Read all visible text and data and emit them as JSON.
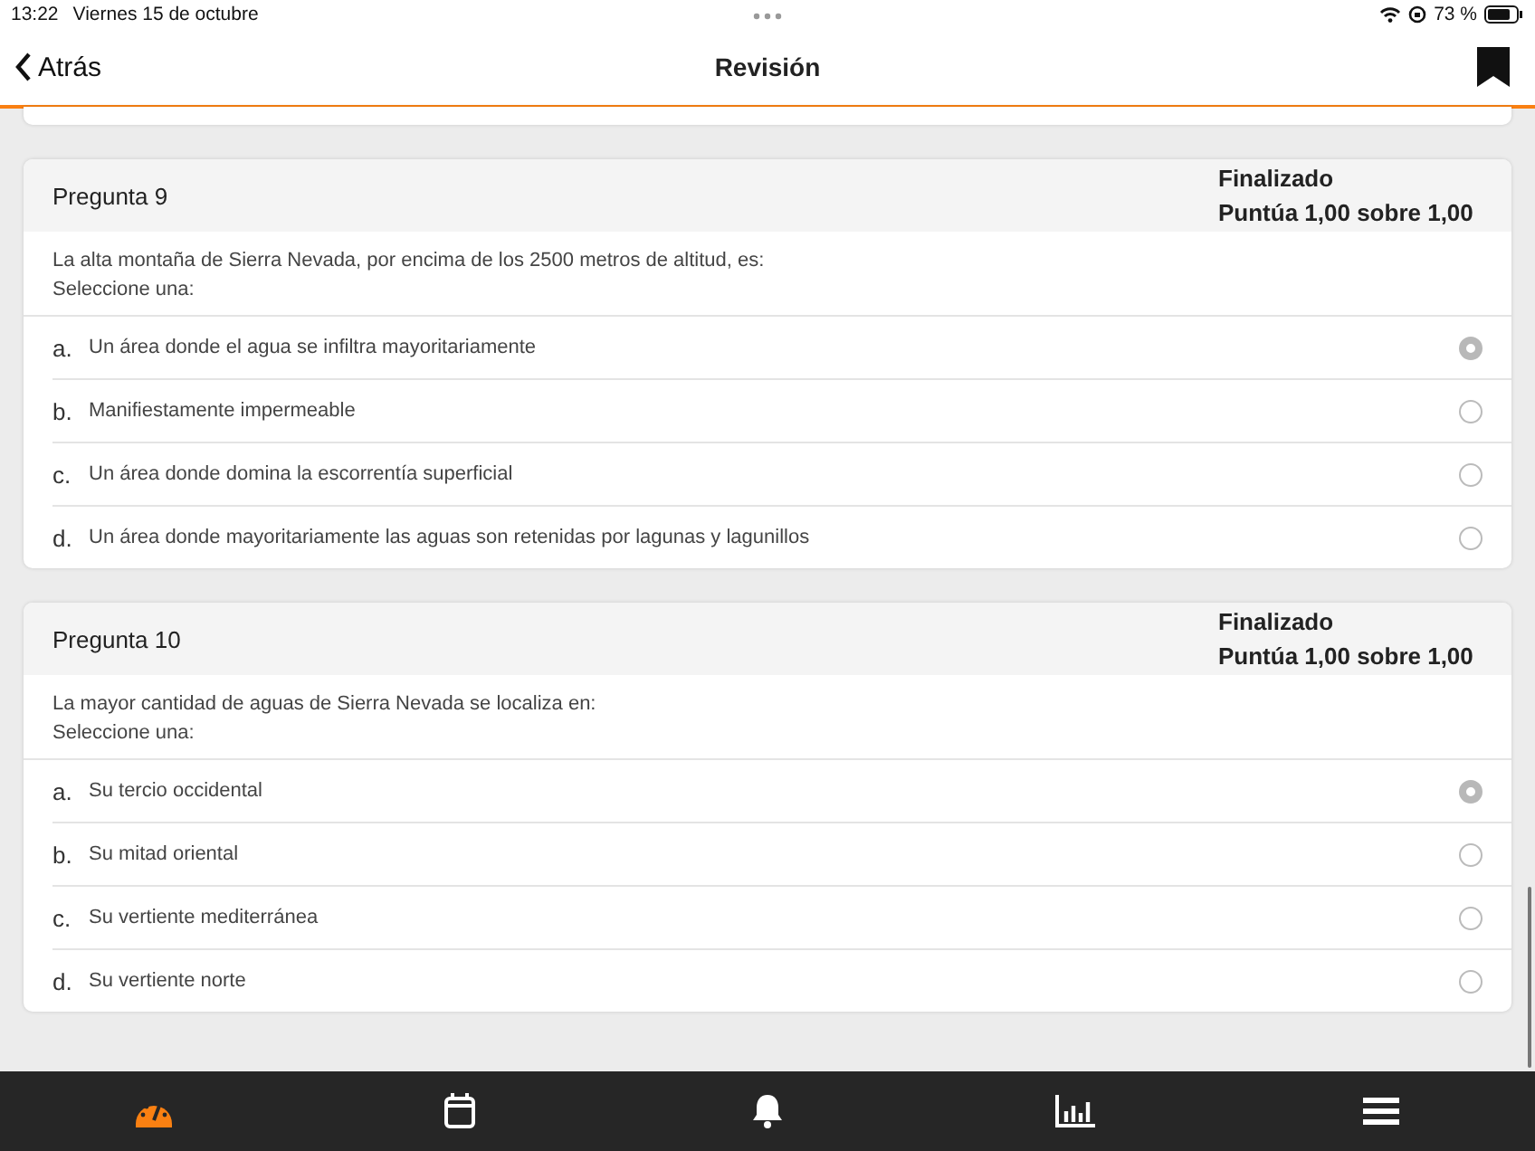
{
  "status_bar": {
    "time": "13:22",
    "date": "Viernes 15 de octubre",
    "battery": "73 %"
  },
  "nav": {
    "back": "Atrás",
    "title": "Revisión"
  },
  "questions": [
    {
      "title": "Pregunta 9",
      "state": "Finalizado",
      "grade": "Puntúa 1,00 sobre 1,00",
      "text": "La alta montaña de Sierra Nevada, por encima de los 2500 metros de altitud, es:",
      "prompt": "Seleccione una:",
      "options": [
        {
          "letter": "a.",
          "text": "Un área donde el agua se infiltra mayoritariamente",
          "selected": true
        },
        {
          "letter": "b.",
          "text": "Manifiestamente impermeable",
          "selected": false
        },
        {
          "letter": "c.",
          "text": "Un área donde domina la escorrentía superficial",
          "selected": false
        },
        {
          "letter": "d.",
          "text": "Un área donde mayoritariamente las aguas son retenidas por lagunas y lagunillos",
          "selected": false
        }
      ]
    },
    {
      "title": "Pregunta 10",
      "state": "Finalizado",
      "grade": "Puntúa 1,00 sobre 1,00",
      "text": "La mayor cantidad de aguas de Sierra Nevada se localiza en:",
      "prompt": "Seleccione una:",
      "options": [
        {
          "letter": "a.",
          "text": "Su tercio occidental",
          "selected": true
        },
        {
          "letter": "b.",
          "text": "Su mitad oriental",
          "selected": false
        },
        {
          "letter": "c.",
          "text": "Su vertiente mediterránea",
          "selected": false
        },
        {
          "letter": "d.",
          "text": "Su vertiente norte",
          "selected": false
        }
      ]
    }
  ],
  "tab_bar": [
    {
      "kind": "dashboard",
      "selected": true
    },
    {
      "kind": "calendar",
      "selected": false
    },
    {
      "kind": "bell",
      "selected": false
    },
    {
      "kind": "chart",
      "selected": false
    },
    {
      "kind": "menu",
      "selected": false
    }
  ]
}
